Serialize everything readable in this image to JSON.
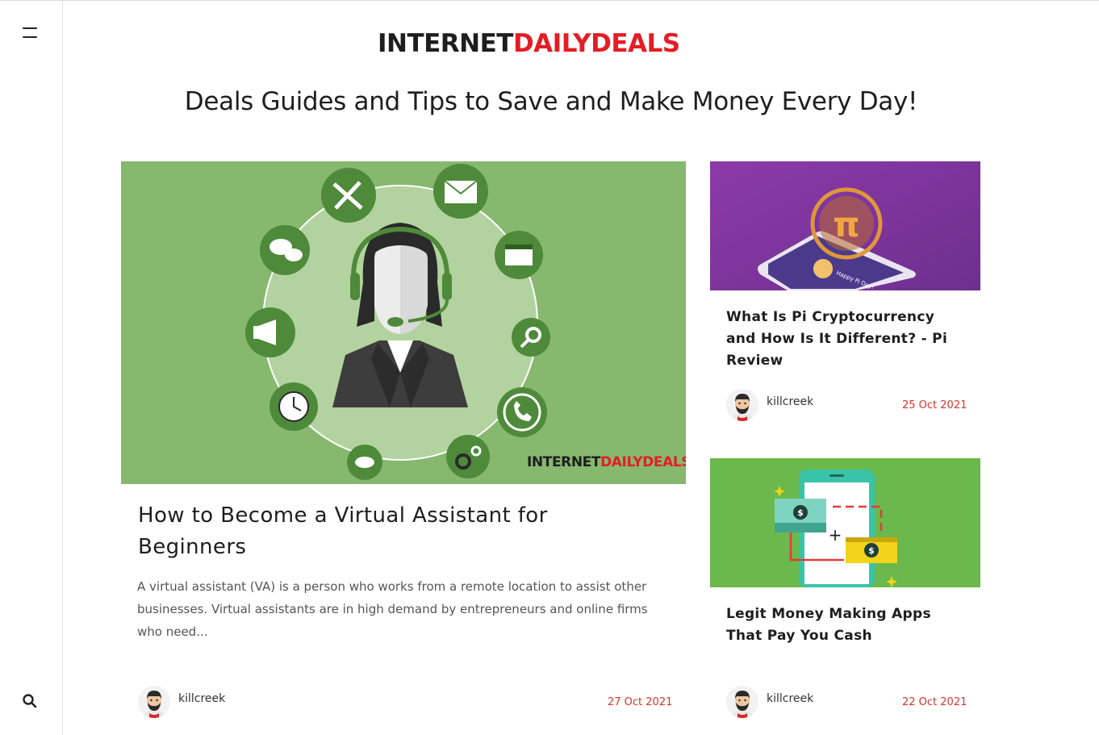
{
  "site": {
    "logo_part1": "INTERNET",
    "logo_part2": "DAILYDEALS",
    "tagline": "Deals Guides and Tips to Save and Make Money Every Day!"
  },
  "sidebar": {
    "menu_icon": "hamburger-menu-icon",
    "search_icon": "search-icon"
  },
  "featured": {
    "image_watermark_part1": "INTERNET",
    "image_watermark_part2": "DAILYDEALS",
    "title": "How to Become a Virtual Assistant for Beginners",
    "excerpt": "A virtual assistant (VA) is a person who works from a remote location to assist other businesses. Virtual assistants are in high demand by entrepreneurs and online firms who need...",
    "author": "killcreek",
    "date": "27 Oct 2021"
  },
  "side_articles": [
    {
      "title": "What Is Pi Cryptocurrency and How Is It Different? - Pi Review",
      "author": "killcreek",
      "date": "25 Oct 2021",
      "phone_banner": "Happy Pi Day!"
    },
    {
      "title": "Legit Money Making Apps That Pay You Cash",
      "author": "killcreek",
      "date": "22 Oct 2021"
    }
  ],
  "colors": {
    "brand_red": "#e31e24",
    "date_red": "#d9332b",
    "feature_green": "#86b86e",
    "pi_purple": "#8a3fa0",
    "apps_green": "#6bb84c"
  }
}
